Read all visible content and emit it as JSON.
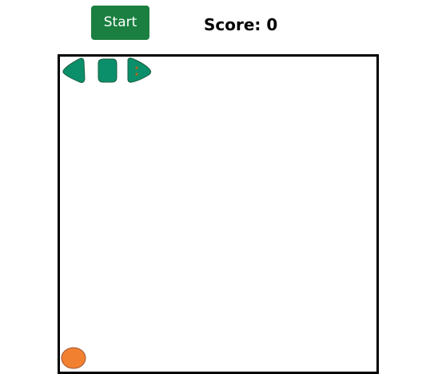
{
  "toolbar": {
    "start_label": "Start",
    "score_text": "Score: 0"
  },
  "game": {
    "snake": {
      "segments": [
        "head-left",
        "body",
        "tail-right"
      ],
      "color": "#0b8f6a",
      "outline": "#1a5e3f",
      "eye_color": "#b5651d"
    },
    "food": {
      "color": "#f28031",
      "outline": "#a0522d"
    }
  },
  "colors": {
    "button_bg": "#1a7f40",
    "board_border": "#000000"
  }
}
